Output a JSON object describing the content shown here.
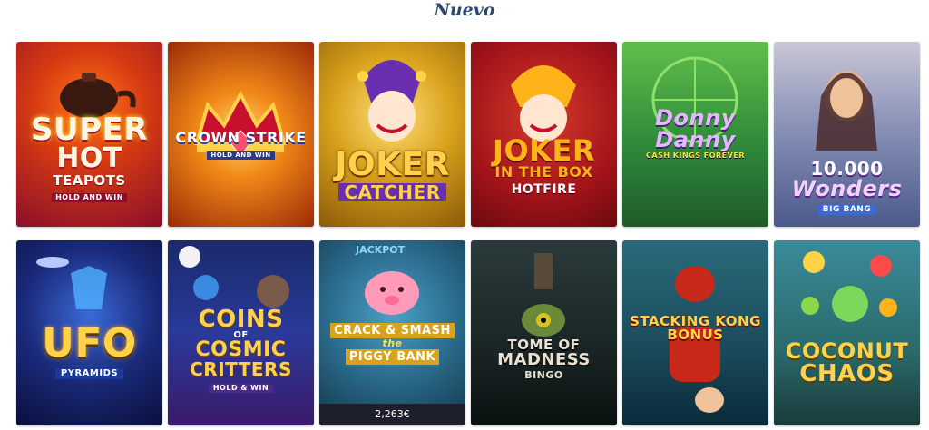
{
  "section": {
    "title": "Nuevo"
  },
  "games": [
    {
      "l1": "SUPER",
      "l2": "HOT",
      "l3": "TEAPOTS",
      "l4": "HOLD AND WIN"
    },
    {
      "l1": "CROWN STRIKE",
      "l2": "HOLD AND WIN"
    },
    {
      "l1": "JOKER",
      "l2": "CATCHER"
    },
    {
      "l1": "JOKER",
      "l2": "IN THE BOX",
      "l3": "HOTFIRE"
    },
    {
      "l1": "Donny",
      "l2": "Danny",
      "l3": "CASH KINGS FOREVER"
    },
    {
      "l1": "10.000",
      "l2": "Wonders",
      "l3": "BIG BANG"
    },
    {
      "l1": "UFO",
      "l2": "PYRAMIDS"
    },
    {
      "l1": "COINS",
      "l2": "OF",
      "l3": "COSMIC",
      "l4": "CRITTERS",
      "l5": "HOLD & WIN"
    },
    {
      "badge": "JACKPOT",
      "l1": "CRACK & SMASH",
      "l2": "the",
      "l3": "PIGGY BANK",
      "jackpot": "2,263€"
    },
    {
      "l1": "TOME OF",
      "l2": "MADNESS",
      "l3": "BINGO"
    },
    {
      "l1": "STACKING KONG",
      "l2": "BONUS"
    },
    {
      "l1": "COCONUT",
      "l2": "CHAOS"
    }
  ]
}
